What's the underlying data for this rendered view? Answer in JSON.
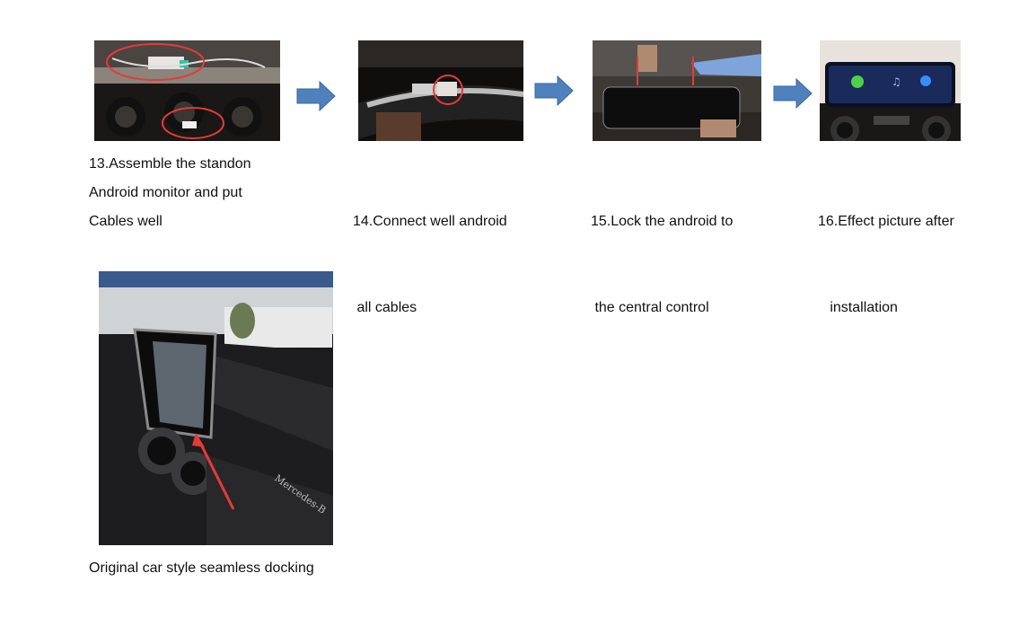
{
  "steps": [
    {
      "caption": [
        "13.Assemble the standon",
        "Android monitor and put",
        "Cables well"
      ]
    },
    {
      "caption": [
        "14.Connect well android",
        " all cables"
      ]
    },
    {
      "caption": [
        "15.Lock the android to",
        " the central control"
      ]
    },
    {
      "caption": [
        "16.Effect picture after",
        "   installation"
      ]
    }
  ],
  "final": {
    "caption": "Original car style seamless docking",
    "brand_text": "Mercedes-B"
  }
}
